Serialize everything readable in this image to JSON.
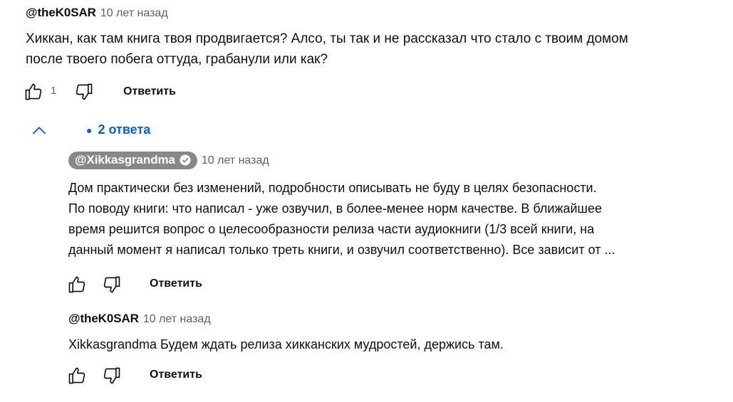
{
  "comment": {
    "author": "@theK0SAR",
    "time": "10 лет назад",
    "text_line1": "Хиккан, как там книга твоя продвигается? Алсо, ты так и не рассказал что стало с твоим домом",
    "text_line2": "после твоего побега оттуда, грабанули или как?",
    "like_count": "1",
    "reply_label": "Ответить"
  },
  "replies_toggle": {
    "label": "2 ответа"
  },
  "replies": [
    {
      "author": "@Xikkasgrandma",
      "time": "10 лет назад",
      "text_line1": "Дом практически без изменений, подробности описывать не буду в целях безопасности.",
      "text_line2": "По поводу книги: что написал - уже озвучил, в более-менее норм качестве. В ближайшее",
      "text_line3": "время решится вопрос о целесообразности релиза части аудиокниги (1/3 всей книги, на",
      "text_line4": "данный момент я написал только треть книги, и озвучил соответственно). Все зависит от ...",
      "reply_label": "Ответить"
    },
    {
      "author": "@theK0SAR",
      "time": "10 лет назад",
      "text_line1": "Xikkasgrandma Будем ждать релиза хикканских мудростей, держись там.",
      "reply_label": "Ответить"
    }
  ],
  "icons": {
    "like": "thumbs-up-icon",
    "dislike": "thumbs-down-icon",
    "collapse": "chevron-up-icon",
    "verified": "check-circle-icon"
  },
  "colors": {
    "link_blue": "#065fd4",
    "secondary_text": "#606060",
    "author_chip_bg": "#888888"
  }
}
